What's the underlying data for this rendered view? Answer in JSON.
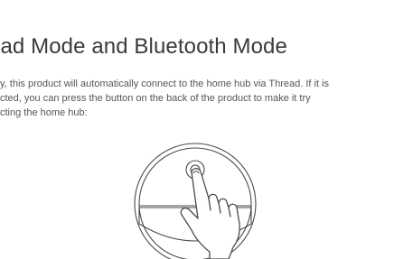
{
  "section": {
    "heading": "ead Mode and Bluetooth Mode",
    "body_lines": [
      "y, this product will automatically connect to the home hub via Thread. If it is",
      "cted, you can press the button on the back of the product to make it try",
      "cting the home hub:"
    ]
  },
  "illustration": {
    "icons": [
      "device-outline-icon",
      "hand-pointer-icon"
    ],
    "stroke_color": "#4a4a4a"
  }
}
